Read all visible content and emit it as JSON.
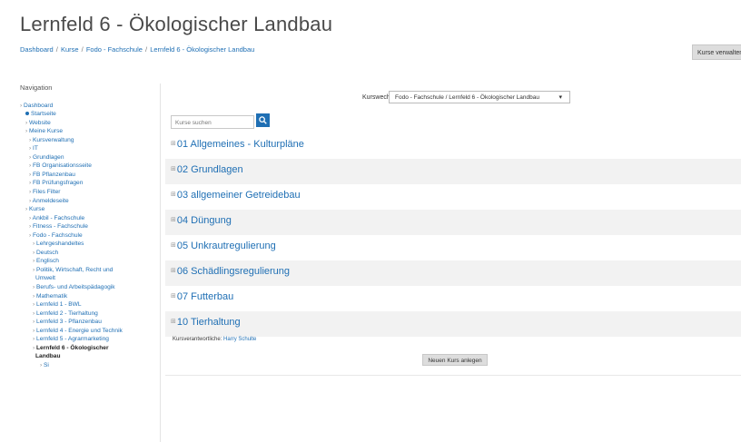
{
  "page": {
    "title": "Lernfeld 6 - Ökologischer Landbau"
  },
  "breadcrumb": [
    "Dashboard",
    "Kurse",
    "Fodo - Fachschule",
    "Lernfeld 6 - Ökologischer Landbau"
  ],
  "top_button": {
    "label": "Kurse verwalten"
  },
  "nav": {
    "title": "Navigation",
    "items": [
      {
        "text": "Dashboard",
        "type": "link"
      },
      {
        "text": "Startseite",
        "type": "dot"
      },
      {
        "text": "Website",
        "type": "link"
      },
      {
        "text": "Meine Kurse",
        "type": "link"
      },
      {
        "text": "Kursverwaltung",
        "type": "link"
      },
      {
        "text": "IT",
        "type": "link"
      },
      {
        "text": "Grundlagen",
        "type": "link"
      },
      {
        "text": "FB Organisationsseite",
        "type": "link"
      },
      {
        "text": "FB Pflanzenbau",
        "type": "link"
      },
      {
        "text": "FB Prüfungsfragen",
        "type": "link"
      },
      {
        "text": "Files Filter",
        "type": "link"
      },
      {
        "text": "Anmeldeseite",
        "type": "link"
      },
      {
        "text": "Kurse",
        "type": "link"
      },
      {
        "text": "Ankbil - Fachschule",
        "type": "link"
      },
      {
        "text": "Fitness - Fachschule",
        "type": "link"
      },
      {
        "text": "Fodo - Fachschule",
        "type": "link"
      },
      {
        "text": "Lehrgeshandeltes",
        "type": "link"
      },
      {
        "text": "Deutsch",
        "type": "link"
      },
      {
        "text": "Englisch",
        "type": "link"
      },
      {
        "text": "Politik, Wirtschaft, Recht und",
        "type": "link"
      },
      {
        "text": "Umwelt",
        "type": "link"
      },
      {
        "text": "Berufs- und Arbeitspädagogik",
        "type": "link"
      },
      {
        "text": "Mathematik",
        "type": "link"
      },
      {
        "text": "Lernfeld 1 - BWL",
        "type": "link"
      },
      {
        "text": "Lernfeld 2 - Tierhaltung",
        "type": "link"
      },
      {
        "text": "Lernfeld 3 - Pflanzenbau",
        "type": "link"
      },
      {
        "text": "Lernfeld 4 - Energie und Technik",
        "type": "link"
      },
      {
        "text": "Lernfeld 5 - Agrarmarketing",
        "type": "link"
      },
      {
        "text": "Lernfeld 6 - Ökologischer",
        "type": "bold"
      },
      {
        "text": "Landbau",
        "type": "bold"
      },
      {
        "text": "Si",
        "type": "link"
      }
    ]
  },
  "jump": {
    "label": "Kurswechsel",
    "value": "Fodo - Fachschule / Lernfeld 6 - Ökologischer Landbau"
  },
  "search": {
    "placeholder": "Kurse suchen"
  },
  "sections": [
    "01 Allgemeines - Kulturpläne",
    "02 Grundlagen",
    "03 allgemeiner Getreidebau",
    "04 Düngung",
    "05 Unkrautregulierung",
    "06 Schädlingsregulierung",
    "07 Futterbau",
    "10 Tierhaltung"
  ],
  "teachers": {
    "label": "Kursverantwortliche:",
    "name": "Harry Schulte"
  },
  "add_button": {
    "label": "Neuen Kurs anlegen"
  },
  "colors": {
    "link": "#1f6fb4",
    "stripe": "#f2f2f2",
    "button": "#dddddd"
  }
}
